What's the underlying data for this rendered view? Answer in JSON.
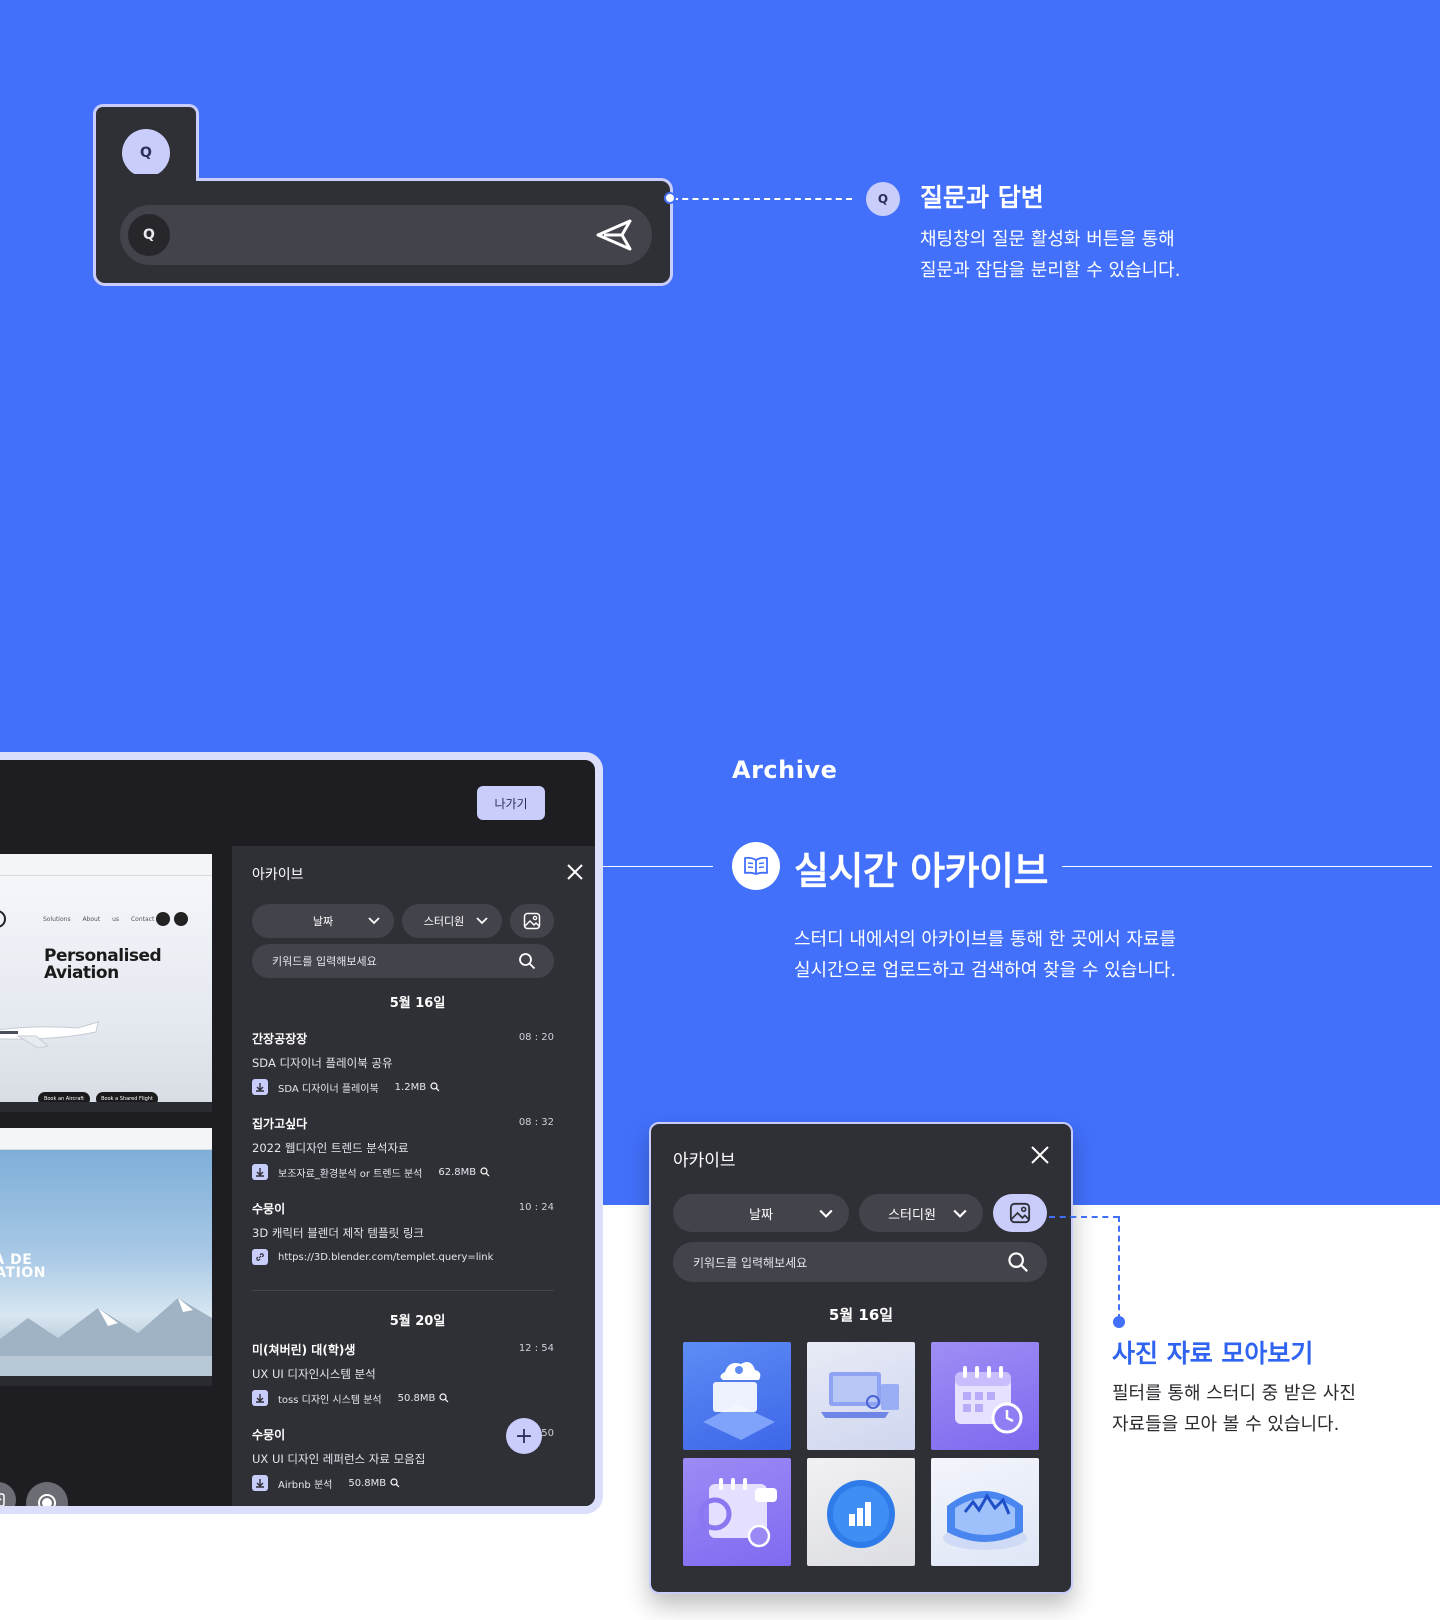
{
  "qa": {
    "badge": "Q",
    "input_badge": "Q",
    "title": "질문과 답변",
    "desc_line1": "채팅창의 질문 활성화 버튼을 통해",
    "desc_line2": "질문과 잡담을 분리할 수 있습니다.",
    "connector_badge": "Q"
  },
  "screen": {
    "exit_label": "나가기",
    "shot1": {
      "nav": "Solutions About us Contact",
      "logo": "R",
      "headline_line1": "Personalised",
      "headline_line2": "Aviation",
      "pill1": "Book an Aircraft",
      "pill2": "Book a Shared Flight"
    },
    "shot2": {
      "headline_line1": "LÀ DE",
      "headline_line2": "RATION"
    },
    "panel": {
      "title": "아카이브",
      "filter_date": "날짜",
      "filter_member": "스터디원",
      "search_placeholder": "키워드를 입력해보세요",
      "groups": [
        {
          "date": "5월 16일",
          "entries": [
            {
              "who": "간장공장장",
              "time": "08 : 20",
              "msg": "SDA 디자이너 플레이북 공유",
              "file": "SDA 디자이너 플레이북",
              "size": "1.2MB"
            },
            {
              "who": "집가고싶다",
              "time": "08 : 32",
              "msg": "2022 웹디자인 트렌드 분석자료",
              "file": "보조자료_환경분석 or 트렌드 분석",
              "size": "62.8MB"
            },
            {
              "who": "수뭉이",
              "time": "10 : 24",
              "msg": "3D 캐릭터 블렌더 제작 템플릿 링크",
              "file": "https://3D.blender.com/templet.query=link",
              "size": ""
            }
          ]
        },
        {
          "date": "5월 20일",
          "entries": [
            {
              "who": "미(쳐버린) 대(학)생",
              "time": "12 : 54",
              "msg": "UX UI 디자인시스템 분석",
              "file": "toss 디자인 시스템 분석",
              "size": "50.8MB"
            },
            {
              "who": "수뭉이",
              "time": "50",
              "msg": "UX UI 디자인 레퍼런스 자료 모음집",
              "file": "Airbnb 분석",
              "size": "50.8MB"
            }
          ]
        }
      ],
      "fab": "+"
    }
  },
  "archive": {
    "label": "Archive",
    "title": "실시간 아카이브",
    "desc_line1": "스터디 내에서의 아카이브를 통해 한 곳에서 자료를",
    "desc_line2": "실시간으로 업로드하고 검색하여 찾을 수 있습니다."
  },
  "small_panel": {
    "title": "아카이브",
    "filter_date": "날짜",
    "filter_member": "스터디원",
    "search_placeholder": "키워드를 입력해보세요",
    "date": "5월 16일"
  },
  "photo": {
    "title": "사진 자료 모아보기",
    "desc_line1": "필터를 통해 스터디 중 받은 사진",
    "desc_line2": "자료들을 모아 볼 수 있습니다."
  },
  "colors": {
    "brand_blue": "#4270fb",
    "panel_dark": "#2f2f36",
    "accent_lavender": "#c9cdfb"
  }
}
